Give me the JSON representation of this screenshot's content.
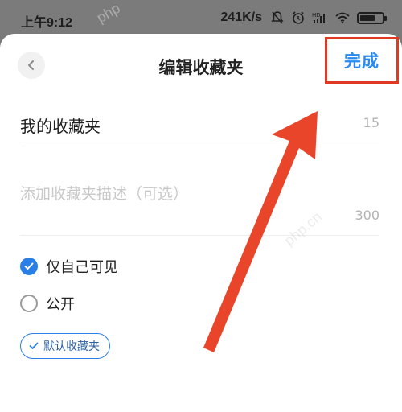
{
  "status_bar": {
    "time": "上午9:12",
    "speed": "241K/s",
    "icons": [
      "mute-bell-icon",
      "alarm-icon",
      "hd-signal-icon",
      "wifi-icon",
      "battery-icon"
    ]
  },
  "header": {
    "title": "编辑收藏夹",
    "done_label": "完成",
    "back_icon": "chevron-left-icon"
  },
  "form": {
    "name_value": "我的收藏夹",
    "name_counter": "15",
    "desc_placeholder": "添加收藏夹描述（可选）",
    "desc_counter": "300"
  },
  "visibility": {
    "options": [
      {
        "label": "仅自己可见",
        "checked": true
      },
      {
        "label": "公开",
        "checked": false
      }
    ]
  },
  "default_chip": {
    "label": "默认收藏夹",
    "icon": "check-icon"
  },
  "watermark": "php",
  "watermark2": "php.cn",
  "colors": {
    "accent": "#2a7fe6",
    "annotation_red": "#e03a25"
  }
}
